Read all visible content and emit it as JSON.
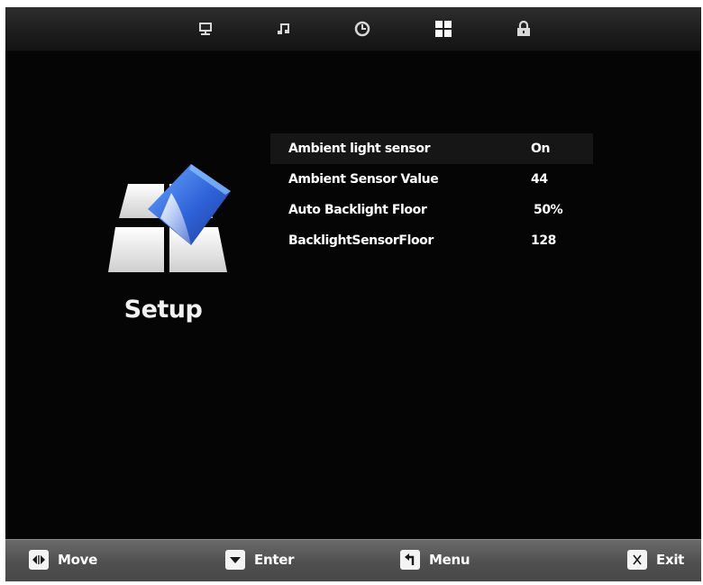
{
  "top_tabs": [
    {
      "icon": "monitor-icon"
    },
    {
      "icon": "music-note-icon"
    },
    {
      "icon": "clock-icon"
    },
    {
      "icon": "setup-grid-icon",
      "selected": true
    },
    {
      "icon": "lock-icon"
    }
  ],
  "section": {
    "title": "Setup",
    "icon": "setup-icon"
  },
  "settings": [
    {
      "label": "Ambient light sensor",
      "value": "On",
      "selected": true
    },
    {
      "label": "Ambient Sensor Value",
      "value": "44"
    },
    {
      "label": "Auto Backlight Floor",
      "value": "50%"
    },
    {
      "label": "BacklightSensorFloor",
      "value": "128"
    }
  ],
  "hints": [
    {
      "key_icon": "left-right-arrows-icon",
      "label": "Move"
    },
    {
      "key_icon": "down-triangle-icon",
      "label": "Enter"
    },
    {
      "key_icon": "return-arrow-icon",
      "label": "Menu"
    },
    {
      "key_icon": "x-icon",
      "label": "Exit"
    }
  ],
  "colors": {
    "background": "#050505",
    "topbar": "#242424",
    "bottombar": "#555555",
    "text": "#ffffff"
  }
}
